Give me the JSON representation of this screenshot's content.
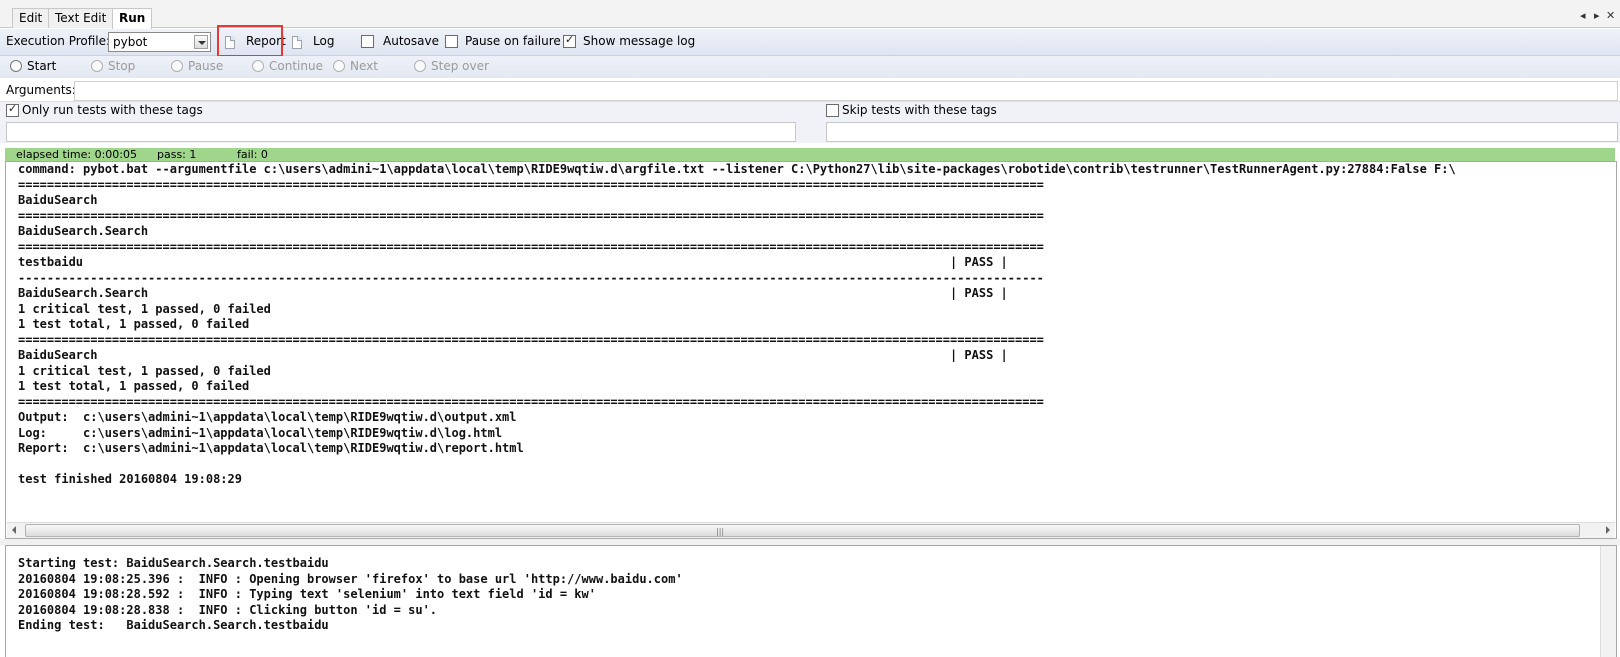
{
  "tabs": [
    {
      "label": "Edit"
    },
    {
      "label": "Text Edit"
    },
    {
      "label": "Run"
    }
  ],
  "profile_bar": {
    "label": "Execution Profile:",
    "profile_value": "pybot",
    "report_label": "Report",
    "log_label": "Log",
    "autosave_label": "Autosave",
    "autosave_checked": false,
    "pause_on_failure_label": "Pause on failure",
    "pause_on_failure_checked": false,
    "show_message_log_label": "Show message log",
    "show_message_log_checked": true,
    "highlight_color": "#e53935"
  },
  "run_controls": {
    "start": "Start",
    "stop": "Stop",
    "pause": "Pause",
    "continue": "Continue",
    "next": "Next",
    "step_over": "Step over"
  },
  "arguments": {
    "label": "Arguments:",
    "value": ""
  },
  "tags": {
    "only_run_label": "Only run tests with these tags",
    "only_run_checked": true,
    "only_run_value": "",
    "skip_label": "Skip tests with these tags",
    "skip_checked": false,
    "skip_value": ""
  },
  "status": {
    "elapsed": "elapsed time: 0:00:05",
    "pass": "pass: 1",
    "fail": "fail: 0",
    "color": "#9fd68c"
  },
  "output_lines": [
    "command: pybot.bat --argumentfile c:\\users\\admini~1\\appdata\\local\\temp\\RIDE9wqtiw.d\\argfile.txt --listener C:\\Python27\\lib\\site-packages\\robotide\\contrib\\testrunner\\TestRunnerAgent.py:27884:False F:\\",
    "==============================================================================================================================================",
    "BaiduSearch",
    "==============================================================================================================================================",
    "BaiduSearch.Search",
    "==============================================================================================================================================",
    "testbaidu                                                                                                                        | PASS |",
    "----------------------------------------------------------------------------------------------------------------------------------------------",
    "BaiduSearch.Search                                                                                                               | PASS |",
    "1 critical test, 1 passed, 0 failed",
    "1 test total, 1 passed, 0 failed",
    "==============================================================================================================================================",
    "BaiduSearch                                                                                                                      | PASS |",
    "1 critical test, 1 passed, 0 failed",
    "1 test total, 1 passed, 0 failed",
    "==============================================================================================================================================",
    "Output:  c:\\users\\admini~1\\appdata\\local\\temp\\RIDE9wqtiw.d\\output.xml",
    "Log:     c:\\users\\admini~1\\appdata\\local\\temp\\RIDE9wqtiw.d\\log.html",
    "Report:  c:\\users\\admini~1\\appdata\\local\\temp\\RIDE9wqtiw.d\\report.html",
    "",
    "test finished 20160804 19:08:29"
  ],
  "message_log_lines": [
    "Starting test: BaiduSearch.Search.testbaidu",
    "20160804 19:08:25.396 :  INFO : Opening browser 'firefox' to base url 'http://www.baidu.com'",
    "20160804 19:08:28.592 :  INFO : Typing text 'selenium' into text field 'id = kw'",
    "20160804 19:08:28.838 :  INFO : Clicking button 'id = su'.",
    "Ending test:   BaiduSearch.Search.testbaidu"
  ]
}
